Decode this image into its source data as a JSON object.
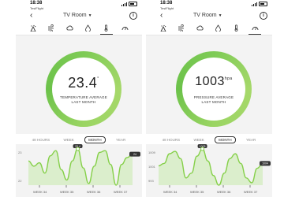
{
  "colors": {
    "ring_green": "#7ecb56",
    "line_green": "#86d04a",
    "fill_green": "#d4ecc2"
  },
  "screens": [
    {
      "status_time": "18:38",
      "carrier": "TestFlight",
      "title": "TV Room",
      "tabs": [
        {
          "icon": "sprayer-icon"
        },
        {
          "icon": "wind-icon"
        },
        {
          "icon": "cloud-icon"
        },
        {
          "icon": "drop-icon"
        },
        {
          "icon": "thermometer-icon",
          "active": true
        },
        {
          "icon": "gauge-icon"
        }
      ],
      "reading": {
        "value": "23.4",
        "unit": "°",
        "caption_line1": "TEMPERATURE AVERAGE",
        "caption_line2": "LAST MONTH"
      },
      "periods": [
        "48 HOURS",
        "WEEK",
        "MONTH",
        "YEAR"
      ],
      "active_period": "MONTH",
      "chart": {
        "y_labels": [
          "23",
          "22"
        ],
        "callouts": [
          "23.4",
          "24"
        ],
        "weeks": [
          "WEEK 34",
          "WEEK 35",
          "WEEK 36",
          "WEEK 37"
        ],
        "series": [
          23.0,
          22.7,
          22.9,
          22.3,
          23.3,
          23.6,
          22.5,
          21.9,
          23.0,
          23.7,
          22.6,
          21.7,
          22.7,
          23.5,
          23.6,
          22.8,
          21.6,
          22.8,
          23.2,
          23.4
        ]
      }
    },
    {
      "status_time": "18:38",
      "carrier": "TestFlight",
      "title": "TV Room",
      "tabs": [
        {
          "icon": "sprayer-icon"
        },
        {
          "icon": "wind-icon"
        },
        {
          "icon": "cloud-icon"
        },
        {
          "icon": "drop-icon"
        },
        {
          "icon": "thermometer-icon"
        },
        {
          "icon": "gauge-icon",
          "active": true
        }
      ],
      "reading": {
        "value": "1003",
        "unit": "hpa",
        "caption_line1": "PRESSURE AVERAGE",
        "caption_line2": "LAST MONTH"
      },
      "periods": [
        "48 HOURS",
        "WEEK",
        "MONTH",
        "YEAR"
      ],
      "active_period": "MONTH",
      "chart": {
        "y_labels": [
          "1009",
          "1001",
          "993"
        ],
        "callouts": [
          "1003",
          "1004"
        ],
        "weeks": [
          "WEEK 34",
          "WEEK 35",
          "WEEK 36",
          "WEEK 37"
        ],
        "series": [
          1002,
          1003,
          1007,
          1008,
          1005,
          997,
          999,
          1006,
          1009,
          1004,
          998,
          994,
          999,
          1005,
          1007,
          1003,
          997,
          995,
          1001,
          1003
        ]
      }
    }
  ]
}
